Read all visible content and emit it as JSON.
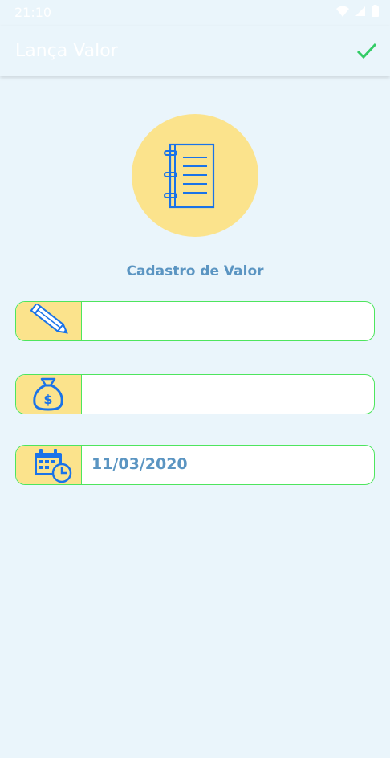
{
  "status_bar": {
    "time": "21:10",
    "icons": [
      "wifi-icon",
      "signal-icon",
      "battery-icon"
    ]
  },
  "app_bar": {
    "title": "Lança Valor",
    "confirm_icon": "check-icon"
  },
  "hero": {
    "icon": "notebook-icon"
  },
  "form": {
    "title": "Cadastro de Valor",
    "fields": [
      {
        "icon": "pencil-icon",
        "value": ""
      },
      {
        "icon": "money-bag-icon",
        "value": ""
      },
      {
        "icon": "calendar-clock-icon",
        "value": "11/03/2020"
      }
    ]
  },
  "colors": {
    "background": "#eaf5fb",
    "accent_yellow": "#fbe38c",
    "border_green": "#4ee55e",
    "text_blue": "#5b95c2",
    "icon_blue": "#1a73e8",
    "check_green": "#33cc66"
  }
}
